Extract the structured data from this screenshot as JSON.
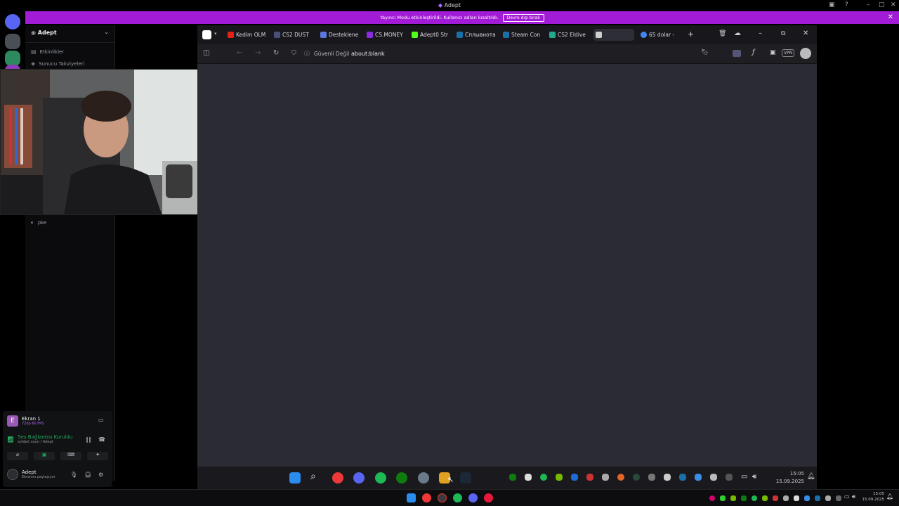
{
  "window": {
    "title": "Adept"
  },
  "banner": {
    "text": "Yayıncı Modu etkinleştirildi. Kullanıcı adları kısaltıldı.",
    "button_label": "Devre dışı bırak"
  },
  "sidebar": {
    "server_name": "Adept",
    "channels": [
      {
        "label": "Etkinlikler",
        "icon": "calendar-icon"
      },
      {
        "label": "Sunucu Takviyeleri",
        "icon": "boost-icon"
      }
    ],
    "voice_channel_fragment": "pke"
  },
  "voice_panel": {
    "stream_title": "Ekran 1",
    "stream_sub": "720p 60 FPS",
    "connection_status": "Ses Bağlantısı Kuruldu",
    "connection_sub": "sohbet oyun / Adept",
    "user_name": "Adept",
    "user_status": "Ekranını paylaşıyor"
  },
  "browser": {
    "tabs": [
      {
        "label": "Kedim OLM",
        "icon": "youtube-icon",
        "color": "#e62117"
      },
      {
        "label": "CS2 DUST",
        "icon": "shield-icon",
        "color": "#4a4f7a"
      },
      {
        "label": "Desteklene",
        "icon": "vivaldi-icon",
        "color": "#5a78e0"
      },
      {
        "label": "CS.MONEY",
        "icon": "csmoney-icon",
        "color": "#8a2be2"
      },
      {
        "label": "Adept0 Str",
        "icon": "kick-icon",
        "color": "#53fc18"
      },
      {
        "label": "Сплывнота",
        "icon": "steam-icon",
        "color": "#1b6fa8"
      },
      {
        "label": "Steam Con",
        "icon": "steam-icon",
        "color": "#1b6fa8"
      },
      {
        "label": "CS2 Eldive",
        "icon": "csfloat-icon",
        "color": "#20a98c"
      },
      {
        "label": "",
        "icon": "blank-page-icon",
        "color": "#cfcfcf"
      },
      {
        "label": "65 dolar -",
        "icon": "google-icon",
        "color": "#4285f4"
      }
    ],
    "security_label": "Güvenli Değil",
    "url": "about:blank",
    "vpn_label": "VPN"
  },
  "taskbar_inner": {
    "time": "15:05",
    "date": "15.09.2025"
  },
  "taskbar_outer": {
    "time": "15:05",
    "date": "15.09.2025"
  }
}
